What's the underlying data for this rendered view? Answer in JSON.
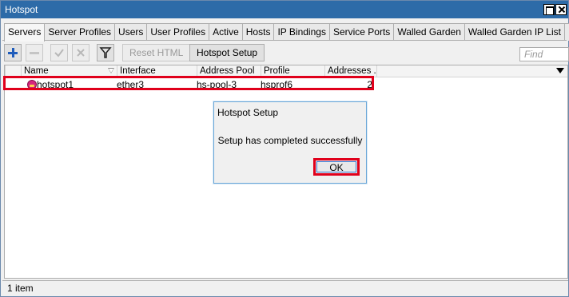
{
  "window": {
    "title": "Hotspot"
  },
  "tabs": [
    {
      "label": "Servers",
      "active": true
    },
    {
      "label": "Server Profiles"
    },
    {
      "label": "Users"
    },
    {
      "label": "User Profiles"
    },
    {
      "label": "Active"
    },
    {
      "label": "Hosts"
    },
    {
      "label": "IP Bindings"
    },
    {
      "label": "Service Ports"
    },
    {
      "label": "Walled Garden"
    },
    {
      "label": "Walled Garden IP List"
    },
    {
      "label": "..."
    }
  ],
  "toolbar": {
    "reset_html_label": "Reset HTML",
    "hotspot_setup_label": "Hotspot Setup",
    "find_placeholder": "Find"
  },
  "table": {
    "columns": [
      "Name",
      "Interface",
      "Address Pool",
      "Profile",
      "Addresses ..."
    ],
    "rows": [
      {
        "name": "hotspot1",
        "interface": "ether3",
        "address_pool": "hs-pool-3",
        "profile": "hsprof6",
        "addresses": "2"
      }
    ]
  },
  "status": {
    "text": "1 item"
  },
  "dialog": {
    "title": "Hotspot Setup",
    "message": "Setup has completed successfully",
    "ok_label": "OK"
  },
  "colors": {
    "titlebar": "#2d6ba8",
    "highlight": "#e0001b"
  }
}
